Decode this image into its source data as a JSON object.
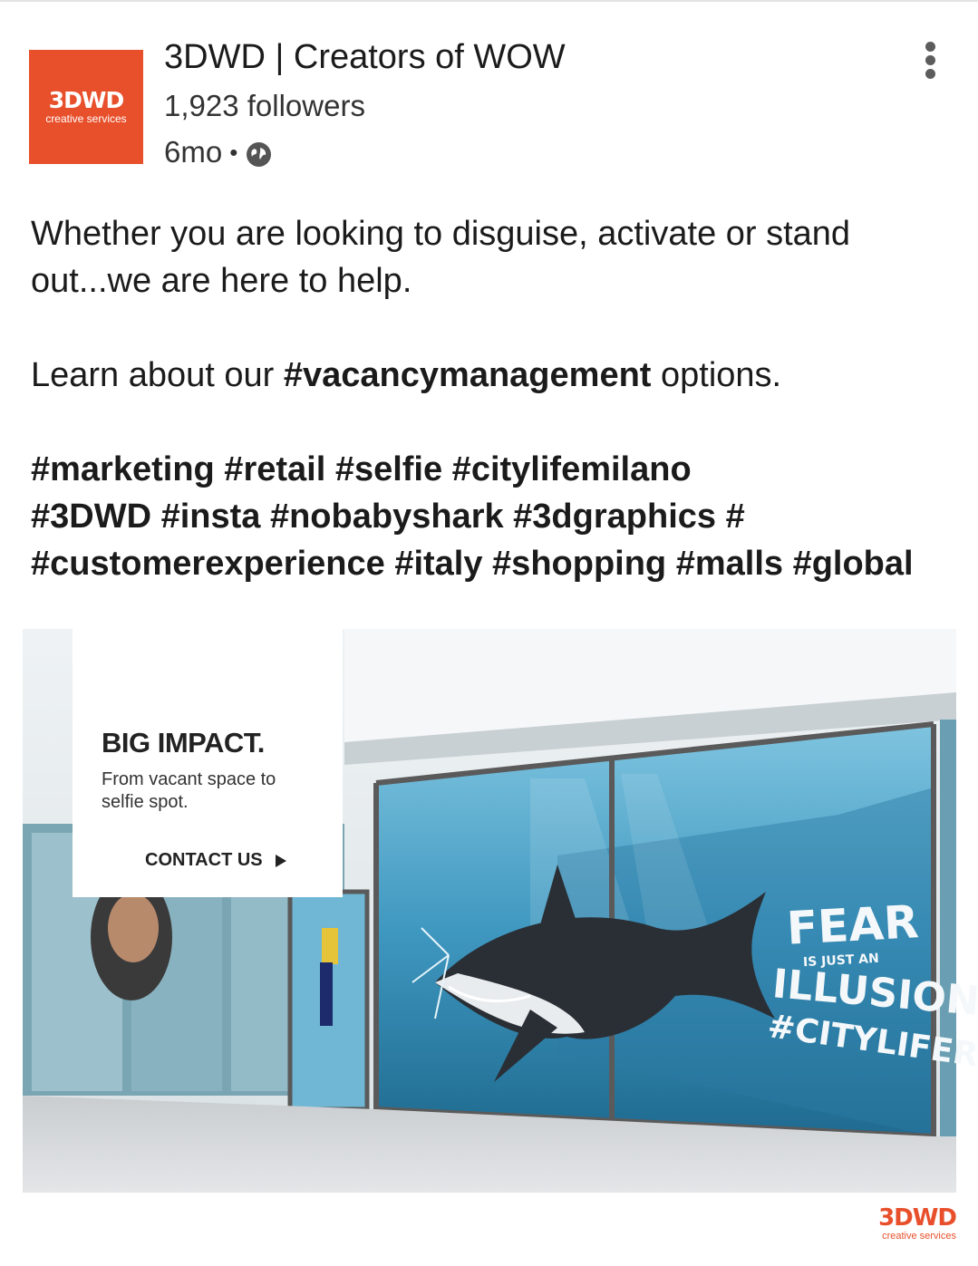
{
  "author": {
    "logo_text": "3DWD",
    "logo_subtext": "creative services",
    "name": "3DWD | Creators of WOW",
    "followers": "1,923 followers",
    "age": "6mo",
    "separator": "•",
    "visibility_icon": "globe-icon"
  },
  "menu": {
    "icon": "more-vertical-icon"
  },
  "post": {
    "line1_a": "Whether you are looking to disguise, activate or stand",
    "line1_b": "out...we are here to help.",
    "learn_prefix": "Learn about our ",
    "learn_hashtag": "#vacancymanagement",
    "learn_suffix": " options.",
    "hashtags_line1": "#marketing #retail #selfie #citylifemilano",
    "hashtags_line2": "#3DWD #insta #nobabyshark #3dgraphics #",
    "hashtags_line3": "#customerexperience  #italy #shopping #malls #global"
  },
  "media": {
    "ad_title": "BIG IMPACT.",
    "ad_subtitle": "From vacant space to selfie spot.",
    "ad_cta": "CONTACT US",
    "mural_fear": "FEAR",
    "mural_is_just_an": "IS JUST AN",
    "mural_illusion": "ILLUSION",
    "mural_hashtag": "#CITYLIFERS",
    "footer_logo_text": "3DWD",
    "footer_logo_subtext": "creative services"
  },
  "colors": {
    "brand": "#e8502c",
    "text": "#1b1b1b",
    "glass": "#4fa6c8"
  }
}
